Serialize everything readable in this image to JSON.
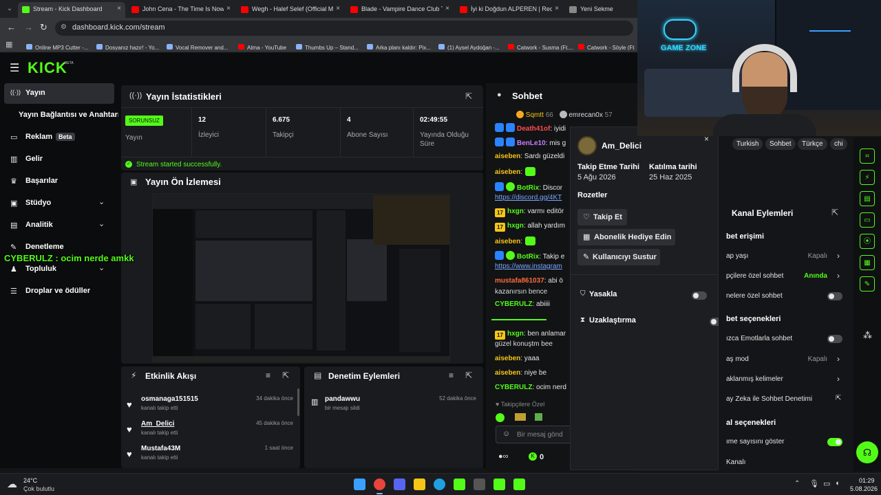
{
  "browser": {
    "tabs": [
      {
        "label": "Stream - Kick Dashboard",
        "active": true
      },
      {
        "label": "John Cena - The Time Is Now (E",
        "active": false
      },
      {
        "label": "Wegh - Halef Selef (Official Mu",
        "active": false
      },
      {
        "label": "Blade - Vampire Dance Club Th",
        "active": false
      },
      {
        "label": "İyi ki Doğdun ALPEREN | Recep",
        "active": false
      },
      {
        "label": "Yeni Sekme",
        "active": false
      }
    ],
    "url": "dashboard.kick.com/stream",
    "bookmarks": [
      "Online MP3 Cutter -...",
      "Dosyanız hazır! - Yo...",
      "Vocal Remover and...",
      "Atma - YouTube",
      "Thumbs Up – Stand...",
      "Arka planı kaldır: Pix...",
      "(1) Aysel Aydoğan -...",
      "Catwork - Susma (Ft....",
      "Catwork - Söyle (Ft...."
    ]
  },
  "logo": {
    "text": "KICK",
    "beta": "BETA"
  },
  "sidebar": {
    "items": [
      {
        "label": "Yayın"
      },
      {
        "label": "Yayın Bağlantısı ve Anahtarı"
      },
      {
        "label": "Reklam",
        "badge": "Beta"
      },
      {
        "label": "Gelir"
      },
      {
        "label": "Başarılar"
      },
      {
        "label": "Stüdyo"
      },
      {
        "label": "Analitik"
      },
      {
        "label": "Denetleme"
      },
      {
        "label": "Topluluk"
      },
      {
        "label": "Droplar ve ödüller"
      }
    ]
  },
  "overlay_chat": "CYBERULZ : ocim nerde amkk",
  "stats": {
    "title": "Yayın İstatistikleri",
    "status_badge": "SORUNSUZ",
    "status_label": "Yayın",
    "cells": [
      {
        "value": "12",
        "label": "İzleyici"
      },
      {
        "value": "6.675",
        "label": "Takipçi"
      },
      {
        "value": "4",
        "label": "Abone Sayısı"
      },
      {
        "value": "02:49:55",
        "label": "Yayında Olduğu Süre"
      }
    ],
    "success": "Stream started successfully."
  },
  "preview": {
    "title": "Yayın Ön İzlemesi"
  },
  "activity": {
    "title": "Etkinlik Akışı",
    "items": [
      {
        "name": "osmanaga151515",
        "action": "kanalı takip etti",
        "time": "34 dakika önce"
      },
      {
        "name": "Am_Delici",
        "action": "kanalı takip etti",
        "time": "45 dakika önce"
      },
      {
        "name": "Mustafa43M",
        "action": "kanalı takip etti",
        "time": "1 saat önce"
      }
    ]
  },
  "moderation": {
    "title": "Denetim Eylemleri",
    "items": [
      {
        "name": "pandawwu",
        "action": "bir mesajı sildi",
        "time": "52 dakika önce"
      }
    ]
  },
  "chat": {
    "title": "Sohbet",
    "top_gifters": [
      {
        "name": "Sqmtt",
        "count": "66"
      },
      {
        "name": "emrecan0x",
        "count": "57"
      }
    ],
    "messages": [
      {
        "user": "Death41of",
        "text": ": iyidi",
        "color": "#ff4d4d"
      },
      {
        "user": "BenLe10",
        "text": ": mis g",
        "color": "#c77dff"
      },
      {
        "user": "aiseben",
        "text": ": Sardı güzeldi",
        "color": "#f5c518"
      },
      {
        "user": "aiseben",
        "text": ":",
        "color": "#f5c518"
      },
      {
        "user": "BotRix",
        "text": ": Discor",
        "color": "#53fc18"
      },
      {
        "user": "",
        "text": "https://discord.gg/4KT",
        "color": "#7aa7ff"
      },
      {
        "user": "hxgn",
        "text": ": varmı editör",
        "color": "#53fc18"
      },
      {
        "user": "hxgn",
        "text": ": allah yardım",
        "color": "#53fc18"
      },
      {
        "user": "aiseben",
        "text": ":",
        "color": "#f5c518"
      },
      {
        "user": "BotRix",
        "text": ": Takip e",
        "color": "#53fc18"
      },
      {
        "user": "",
        "text": "https://www.instagram",
        "color": "#7aa7ff"
      },
      {
        "user": "mustafa861037",
        "text": ": abi ö",
        "color": "#ff6b3d"
      },
      {
        "user": "",
        "text": "kazanırsın bence",
        "color": "#ddd"
      },
      {
        "user": "CYBERULZ",
        "text": ": abiiii",
        "color": "#53fc18"
      },
      {
        "user": "hxgn",
        "text": ": ben anlamar",
        "color": "#53fc18"
      },
      {
        "user": "",
        "text": "güzel konuştm bee",
        "color": "#ddd"
      },
      {
        "user": "aiseben",
        "text": ": yaaa",
        "color": "#f5c518"
      },
      {
        "user": "aiseben",
        "text": ": niye be",
        "color": "#f5c518"
      },
      {
        "user": "CYBERULZ",
        "text": ": ocim nerd",
        "color": "#53fc18"
      }
    ],
    "followers_only": "Takipçilere Özel",
    "input_placeholder": "Bir mesaj gönd",
    "count": "0"
  },
  "user_card": {
    "username": "Am_Delici",
    "follow_date_label": "Takip Etme Tarihi",
    "follow_date": "5 Ağu 2026",
    "join_date_label": "Katılma tarihi",
    "join_date": "25 Haz 2025",
    "badges_label": "Rozetler",
    "follow_btn": "Takip Et",
    "gift_btn": "Abonelik Hediye Edin",
    "mute_btn": "Kullanıcıyı Sustur",
    "ban_label": "Yasakla",
    "timeout_label": "Uzaklaştırma"
  },
  "webcam": {
    "tags": [
      "Turkish",
      "Sohbet",
      "Türkçe",
      "chi"
    ],
    "neon_text": "GAME ZONE"
  },
  "channel_actions": {
    "title": "Kanal Eylemleri",
    "rows": [
      {
        "type": "section",
        "label": "bet erişimi"
      },
      {
        "type": "row",
        "label": "ap yaşı",
        "value": "Kapalı",
        "arrow": true
      },
      {
        "type": "row",
        "label": "pçilere özel sohbet",
        "value": "Anında",
        "green": true,
        "arrow": true
      },
      {
        "type": "toggle",
        "label": "nelere özel sohbet",
        "on": false
      },
      {
        "type": "section",
        "label": "bet seçenekleri"
      },
      {
        "type": "toggle",
        "label": "ızca Emotlarla sohbet",
        "on": false
      },
      {
        "type": "row",
        "label": "aş mod",
        "value": "Kapalı",
        "arrow": true
      },
      {
        "type": "row",
        "label": "aklanmış kelimeler",
        "value": "",
        "arrow": true
      },
      {
        "type": "row",
        "label": "ay Zeka ile Sohbet Denetimi",
        "value": "",
        "ext": true
      },
      {
        "type": "section",
        "label": "al seçenekleri"
      },
      {
        "type": "toggle",
        "label": "ıme sayısını göster",
        "on": true
      },
      {
        "type": "row",
        "label": "Kanalı",
        "value": ""
      }
    ]
  },
  "taskbar": {
    "temp": "24°C",
    "weather": "Çok bulutlu",
    "time": "01:29",
    "date": "5.08.2026"
  }
}
